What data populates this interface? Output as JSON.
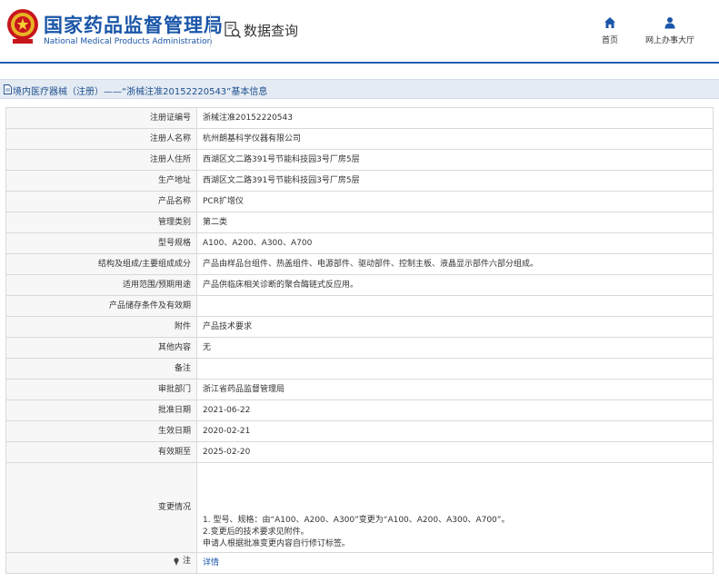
{
  "header": {
    "brand_cn": "国家药品监督管理局",
    "brand_en": "National Medical Products Administration",
    "query_title": "数据查询",
    "nav": [
      {
        "label": "首页",
        "icon": "home-icon"
      },
      {
        "label": "网上办事大厅",
        "icon": "user-icon"
      }
    ]
  },
  "titlebar": {
    "text": "境内医疗器械（注册）——“浙械注准20152220543”基本信息"
  },
  "colors": {
    "brand": "#1a56a8",
    "titlebar_bg": "#e4ebf3",
    "label_bg": "#f7f7f7",
    "border": "#d9d9d9"
  },
  "rows": [
    {
      "label": "注册证编号",
      "value": "浙械注准20152220543"
    },
    {
      "label": "注册人名称",
      "value": "杭州朗基科学仪器有限公司"
    },
    {
      "label": "注册人住所",
      "value": "西湖区文二路391号节能科技园3号厂房5层"
    },
    {
      "label": "生产地址",
      "value": "西湖区文二路391号节能科技园3号厂房5层"
    },
    {
      "label": "产品名称",
      "value": "PCR扩增仪"
    },
    {
      "label": "管理类别",
      "value": "第二类"
    },
    {
      "label": "型号规格",
      "value": "A100、A200、A300、A700"
    },
    {
      "label": "结构及组成/主要组成成分",
      "value": "产品由样品台组件、热盖组件、电源部件、驱动部件、控制主板、液晶显示部件六部分组成。"
    },
    {
      "label": "适用范围/预期用途",
      "value": "产品供临床相关诊断的聚合酶链式反应用。"
    },
    {
      "label": "产品储存条件及有效期",
      "value": ""
    },
    {
      "label": "附件",
      "value": "产品技术要求"
    },
    {
      "label": "其他内容",
      "value": "无"
    },
    {
      "label": "备注",
      "value": ""
    },
    {
      "label": "审批部门",
      "value": "浙江省药品监督管理局"
    },
    {
      "label": "批准日期",
      "value": "2021-06-22"
    },
    {
      "label": "生效日期",
      "value": "2020-02-21"
    },
    {
      "label": "有效期至",
      "value": "2025-02-20"
    }
  ],
  "change_row": {
    "label": "变更情况",
    "lines": [
      "1. 型号、规格：由“A100、A200、A300”变更为“A100、A200、A300、A700”。",
      "2.变更后的技术要求见附件。",
      "申请人根据批准变更内容自行修订标签。"
    ]
  },
  "note_row": {
    "label": "注",
    "icon": "pin-icon",
    "link": "详情"
  }
}
